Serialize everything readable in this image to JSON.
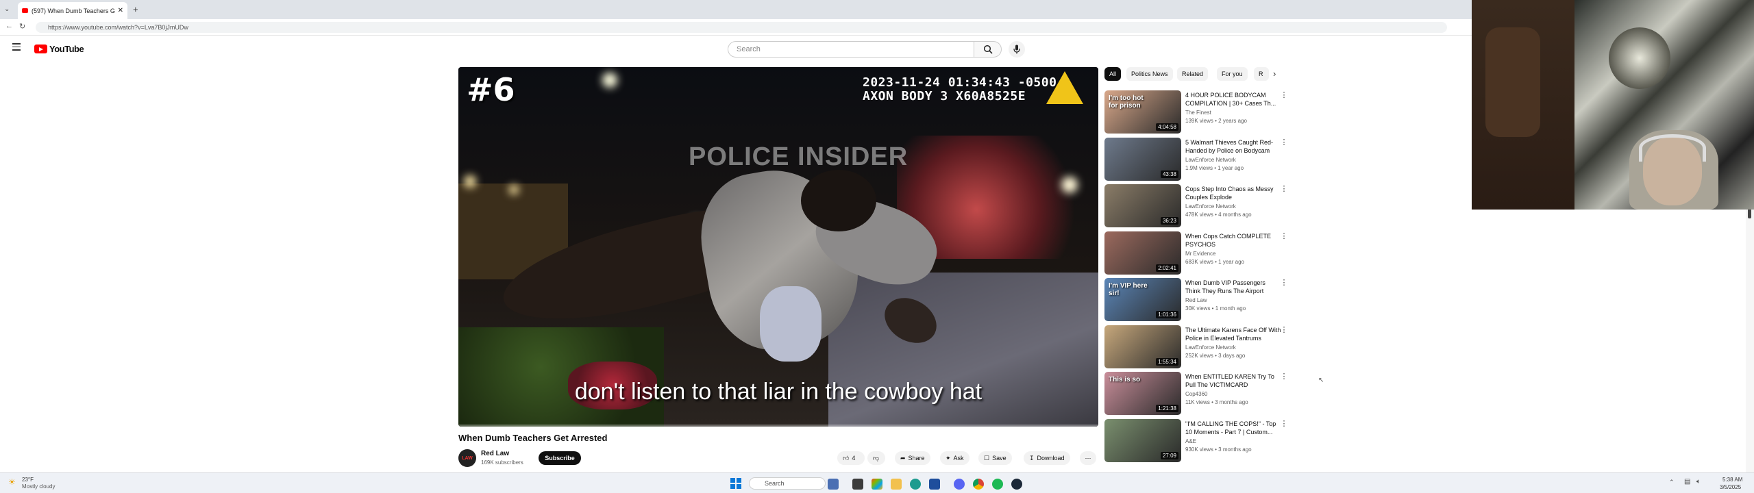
{
  "browser": {
    "tab_title": "(597) When Dumb Teachers G",
    "url": "https://www.youtube.com/watch?v=Lva7B0jJmUDw",
    "new_tab": "+"
  },
  "header": {
    "logo_text": "YouTube",
    "search_placeholder": "Search"
  },
  "video": {
    "number": "#6",
    "stamp_time": "2023-11-24 01:34:43 -0500",
    "stamp_device": "AXON BODY 3 X60A8525E",
    "watermark": "POLICE INSIDER",
    "caption": "don't listen to that liar in the cowboy hat",
    "progress": 0.0
  },
  "video_info": {
    "title": "When Dumb Teachers Get Arrested",
    "channel": "Red Law",
    "avatar_text": "LAW",
    "subscribers": "169K subscribers",
    "subscribe_label": "Subscribe",
    "likes": "4",
    "share_label": "Share",
    "ask_label": "Ask",
    "save_label": "Save",
    "download_label": "Download",
    "more_label": "⋯"
  },
  "chips": [
    "All",
    "Politics News",
    "Related",
    "For you",
    "R"
  ],
  "recommendations": [
    {
      "title": "4 HOUR POLICE BODYCAM COMPILATION | 30+ Cases Th...",
      "channel": "The Finest",
      "meta": "139K views • 2 years ago",
      "duration": "4:04:58",
      "thumb_text": "I'm too hot for prison",
      "color": "#d9a88a"
    },
    {
      "title": "5 Walmart Thieves Caught Red-Handed by Police on Bodycam",
      "channel": "LawEnforce Network",
      "meta": "1.9M views • 1 year ago",
      "duration": "43:38",
      "thumb_text": "",
      "color": "#6e7a8c"
    },
    {
      "title": "Cops Step Into Chaos as Messy Couples Explode",
      "channel": "LawEnforce Network",
      "meta": "478K views • 4 months ago",
      "duration": "36:23",
      "thumb_text": "",
      "color": "#8b7d68"
    },
    {
      "title": "When Cops Catch COMPLETE PSYCHOS",
      "channel": "Mr Evidence",
      "meta": "683K views • 1 year ago",
      "duration": "2:02:41",
      "thumb_text": "",
      "color": "#9c6a5e"
    },
    {
      "title": "When Dumb VIP Passengers Think They Runs The Airport",
      "channel": "Red Law",
      "meta": "30K views • 1 month ago",
      "duration": "1:01:36",
      "thumb_text": "I'm VIP here sir!",
      "color": "#5b86b8"
    },
    {
      "title": "The Ultimate Karens Face Off With Police in Elevated Tantrums",
      "channel": "LawEnforce Network",
      "meta": "252K views • 3 days ago",
      "duration": "1:55:34",
      "thumb_text": "",
      "color": "#c7a87c"
    },
    {
      "title": "When ENTITLED KAREN Try To Pull The VICTIMCARD",
      "channel": "Cop4360",
      "meta": "11K views • 3 months ago",
      "duration": "1:21:38",
      "thumb_text": "This is so",
      "color": "#c98e9a"
    },
    {
      "title": "\"I'M CALLING THE COPS!\" - Top 10 Moments - Part 7 | Custom...",
      "channel": "A&E",
      "meta": "930K views • 3 months ago",
      "duration": "27:09",
      "thumb_text": "",
      "color": "#7a8f6e"
    }
  ],
  "taskbar": {
    "weather_temp": "23°F",
    "weather_text": "Mostly cloudy",
    "search_placeholder": "Search",
    "time": "5:38 AM",
    "date": "3/5/2025"
  }
}
